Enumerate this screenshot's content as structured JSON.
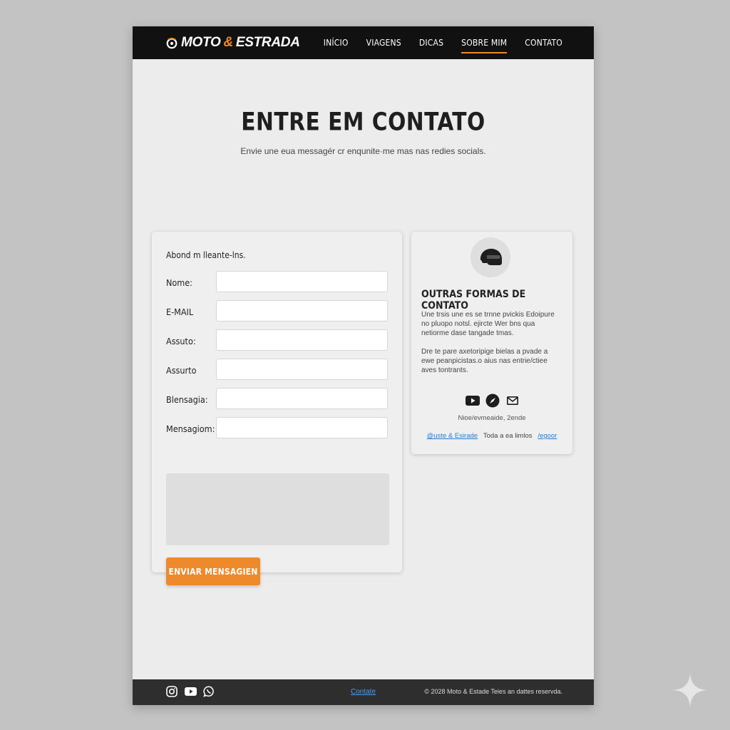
{
  "header": {
    "logo_part1": "MOTO ",
    "logo_amp": "&",
    "logo_part2": " ESTRADA",
    "logo_icon": "moto-wheel-icon",
    "nav": [
      {
        "label": "INÍCIO",
        "active": false
      },
      {
        "label": "VIAGENS",
        "active": false
      },
      {
        "label": "DICAS",
        "active": false
      },
      {
        "label": "SOBRE MIM",
        "active": true
      },
      {
        "label": "CONTATO",
        "active": false
      }
    ]
  },
  "hero": {
    "title": "ENTRE EM CONTATO",
    "subtitle": "Envie une eua messagér cr enqunite·me mas nas redies socials."
  },
  "form": {
    "heading": "Abond m lleante-lns.",
    "fields": [
      {
        "label": "Nome:"
      },
      {
        "label": "E-MAIL"
      },
      {
        "label": "Assuto:"
      },
      {
        "label": "Assurto"
      },
      {
        "label": "Blensagia:"
      },
      {
        "label": "Mensagiom:"
      }
    ],
    "submit_label": "ENVIAR MENSAGIEN"
  },
  "info": {
    "icon": "helmet-icon",
    "title": "OUTRAS FORMAS DE CONTATO",
    "paragraph1": "Une trsis une es se trnne pvickis  Edoipure no pluopo notsl. ejircte Wer bns qua netiorme dase tangade tmas.",
    "paragraph2": "Dre te pare axetoripige bielas a pvade a ewe peanpicistas.o aius nas entrie/ctiee aves tontrants.",
    "social_icons": [
      "youtube-icon",
      "compass-icon",
      "mail-icon"
    ],
    "small_text": "Nioe/evmeaide, 2ende",
    "link_text": "@uste & Esirade",
    "mid_text": "Toda a ea limlos",
    "link2_text": "/egoor"
  },
  "footer": {
    "social_icons": [
      "instagram-icon",
      "youtube-icon",
      "whatsapp-icon"
    ],
    "link": "Contate",
    "copyright": "© 2028 Moto & Estade  Teies an dattes reservda."
  },
  "colors": {
    "accent": "#ee8a2c",
    "header_bg": "#111111",
    "footer_bg": "#2e2e2e",
    "page_bg": "#ececec",
    "link": "#2a7ad6"
  }
}
